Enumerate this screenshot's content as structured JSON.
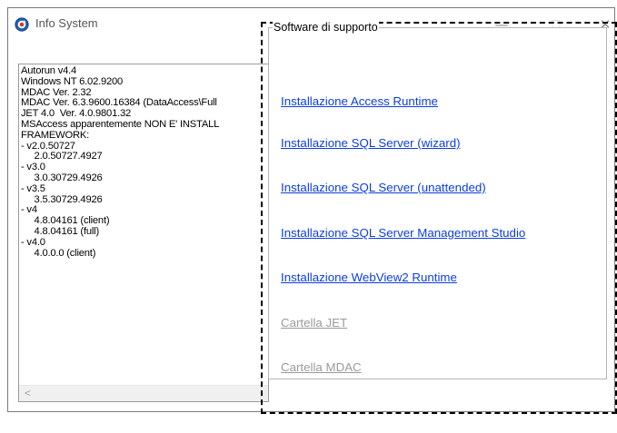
{
  "window": {
    "title": "Info System",
    "icon": "info-system-icon",
    "controls": {
      "minimize": "—",
      "maximize": "☐",
      "close": "✕"
    }
  },
  "info": {
    "lines": [
      "Autorun v4.4",
      "Windows NT 6.02.9200",
      "MDAC Ver. 2.32",
      "MDAC Ver. 6.3.9600.16384 (DataAccess\\Full",
      "JET 4.0  Ver. 4.0.9801.32",
      "MSAccess apparentemente NON E' INSTALL",
      "FRAMEWORK:",
      "- v2.0.50727",
      "     2.0.50727.4927",
      "- v3.0",
      "     3.0.30729.4926",
      "- v3.5",
      "     3.5.30729.4926",
      "- v4",
      "     4.8.04161 (client)",
      "     4.8.04161 (full)",
      "- v4.0",
      "     4.0.0.0 (client)"
    ],
    "scroll_left": "<"
  },
  "support": {
    "legend": "Software di supporto",
    "links": [
      {
        "label": "Installazione Access Runtime",
        "enabled": true
      },
      {
        "label": "Installazione SQL Server  (wizard)",
        "enabled": true
      },
      {
        "label": "Installazione SQL Server (unattended)",
        "enabled": true
      },
      {
        "label": "Installazione SQL Server Management Studio",
        "enabled": true
      },
      {
        "label": "Installazione WebView2 Runtime",
        "enabled": true
      },
      {
        "label": "Cartella JET",
        "enabled": false
      },
      {
        "label": "Cartella MDAC",
        "enabled": false
      }
    ]
  },
  "colors": {
    "link": "#0b3ee0",
    "disabled": "#9a9a9a",
    "border": "#7a7a7a"
  }
}
